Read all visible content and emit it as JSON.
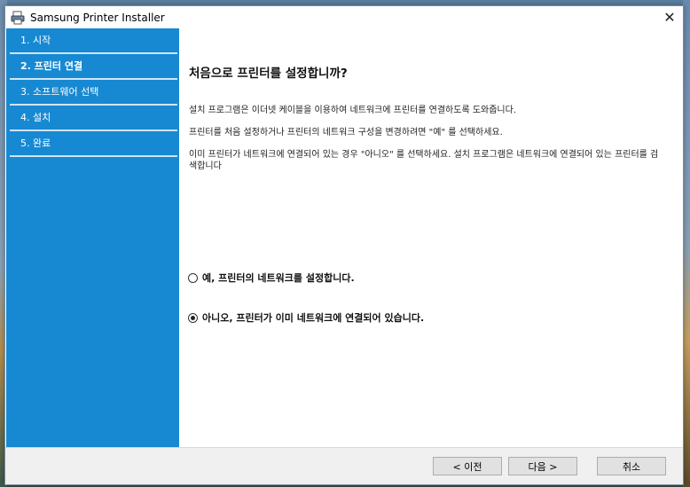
{
  "window": {
    "title": "Samsung Printer Installer",
    "close_glyph": "✕",
    "icon": "printer-installer-icon"
  },
  "sidebar": {
    "items": [
      {
        "label": "1. 시작",
        "active": false
      },
      {
        "label": "2. 프린터 연결",
        "active": true
      },
      {
        "label": "3. 소프트웨어 선택",
        "active": false
      },
      {
        "label": "4. 설치",
        "active": false
      },
      {
        "label": "5. 완료",
        "active": false
      }
    ]
  },
  "main": {
    "heading": "처음으로 프린터를 설정합니까?",
    "paragraphs": [
      "설치 프로그램은 이더넷 케이블을 이용하여 네트워크에 프린터를 연결하도록 도와줍니다.",
      "프린터를 처음 설정하거나 프린터의 네트워크 구성을 변경하려면 \"예\" 를 선택하세요.",
      "이미 프린터가 네트워크에 연결되어 있는 경우 \"아니오\" 를 선택하세요. 설치 프로그램은 네트워크에 연결되어 있는 프린터를 검색합니다"
    ],
    "options": [
      {
        "label": "예, 프린터의 네트워크를 설정합니다.",
        "checked": false
      },
      {
        "label": "아니오, 프린터가 이미 네트워크에 연결되어 있습니다.",
        "checked": true
      }
    ]
  },
  "footer": {
    "back_label": "< 이전",
    "next_label": "다음 >",
    "cancel_label": "취소"
  },
  "colors": {
    "sidebar_bg": "#1789d2",
    "sidebar_divider": "#cfe4f4",
    "footer_bg": "#f0f0f0"
  }
}
